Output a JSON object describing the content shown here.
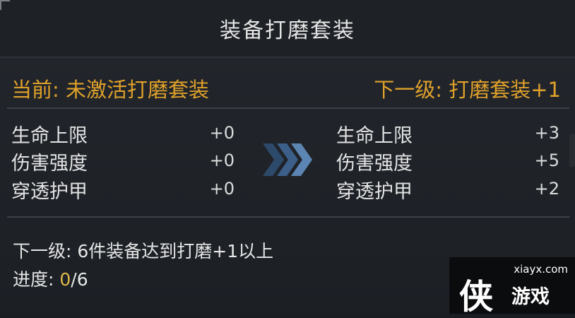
{
  "title": "装备打磨套装",
  "current": {
    "label": "当前:",
    "value": "未激活打磨套装"
  },
  "next": {
    "label": "下一级:",
    "value": "打磨套装+1"
  },
  "stats": [
    {
      "name": "生命上限",
      "current": "+0",
      "next": "+3"
    },
    {
      "name": "伤害强度",
      "current": "+0",
      "next": "+5"
    },
    {
      "name": "穿透护甲",
      "current": "+0",
      "next": "+2"
    }
  ],
  "footer": {
    "requirement": "下一级: 6件装备达到打磨+1以上",
    "progress_label": "进度: ",
    "progress_current": "0",
    "progress_total": "/6"
  },
  "watermark": {
    "url": "xiayx.com",
    "big": "侠",
    "small": "游戏"
  },
  "colors": {
    "accent": "#e0a12a",
    "text": "#e3e3e3",
    "arrow": "#3c5f8a"
  }
}
